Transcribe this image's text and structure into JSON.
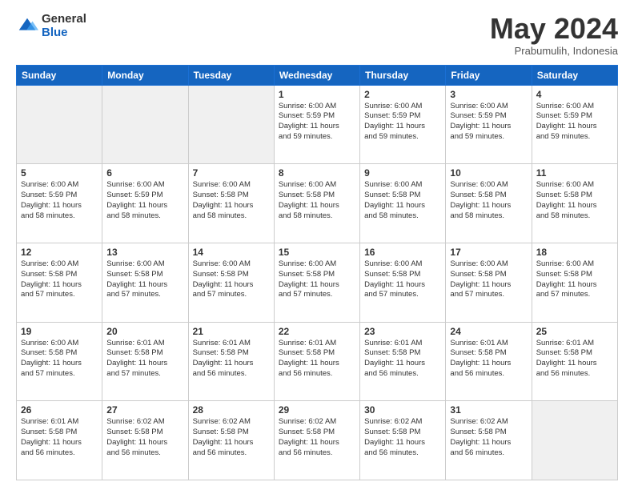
{
  "header": {
    "logo_general": "General",
    "logo_blue": "Blue",
    "month": "May 2024",
    "location": "Prabumulih, Indonesia"
  },
  "weekdays": [
    "Sunday",
    "Monday",
    "Tuesday",
    "Wednesday",
    "Thursday",
    "Friday",
    "Saturday"
  ],
  "weeks": [
    [
      {
        "day": "",
        "info": "",
        "empty": true
      },
      {
        "day": "",
        "info": "",
        "empty": true
      },
      {
        "day": "",
        "info": "",
        "empty": true
      },
      {
        "day": "1",
        "info": "Sunrise: 6:00 AM\nSunset: 5:59 PM\nDaylight: 11 hours\nand 59 minutes.",
        "empty": false
      },
      {
        "day": "2",
        "info": "Sunrise: 6:00 AM\nSunset: 5:59 PM\nDaylight: 11 hours\nand 59 minutes.",
        "empty": false
      },
      {
        "day": "3",
        "info": "Sunrise: 6:00 AM\nSunset: 5:59 PM\nDaylight: 11 hours\nand 59 minutes.",
        "empty": false
      },
      {
        "day": "4",
        "info": "Sunrise: 6:00 AM\nSunset: 5:59 PM\nDaylight: 11 hours\nand 59 minutes.",
        "empty": false
      }
    ],
    [
      {
        "day": "5",
        "info": "Sunrise: 6:00 AM\nSunset: 5:59 PM\nDaylight: 11 hours\nand 58 minutes.",
        "empty": false
      },
      {
        "day": "6",
        "info": "Sunrise: 6:00 AM\nSunset: 5:59 PM\nDaylight: 11 hours\nand 58 minutes.",
        "empty": false
      },
      {
        "day": "7",
        "info": "Sunrise: 6:00 AM\nSunset: 5:58 PM\nDaylight: 11 hours\nand 58 minutes.",
        "empty": false
      },
      {
        "day": "8",
        "info": "Sunrise: 6:00 AM\nSunset: 5:58 PM\nDaylight: 11 hours\nand 58 minutes.",
        "empty": false
      },
      {
        "day": "9",
        "info": "Sunrise: 6:00 AM\nSunset: 5:58 PM\nDaylight: 11 hours\nand 58 minutes.",
        "empty": false
      },
      {
        "day": "10",
        "info": "Sunrise: 6:00 AM\nSunset: 5:58 PM\nDaylight: 11 hours\nand 58 minutes.",
        "empty": false
      },
      {
        "day": "11",
        "info": "Sunrise: 6:00 AM\nSunset: 5:58 PM\nDaylight: 11 hours\nand 58 minutes.",
        "empty": false
      }
    ],
    [
      {
        "day": "12",
        "info": "Sunrise: 6:00 AM\nSunset: 5:58 PM\nDaylight: 11 hours\nand 57 minutes.",
        "empty": false
      },
      {
        "day": "13",
        "info": "Sunrise: 6:00 AM\nSunset: 5:58 PM\nDaylight: 11 hours\nand 57 minutes.",
        "empty": false
      },
      {
        "day": "14",
        "info": "Sunrise: 6:00 AM\nSunset: 5:58 PM\nDaylight: 11 hours\nand 57 minutes.",
        "empty": false
      },
      {
        "day": "15",
        "info": "Sunrise: 6:00 AM\nSunset: 5:58 PM\nDaylight: 11 hours\nand 57 minutes.",
        "empty": false
      },
      {
        "day": "16",
        "info": "Sunrise: 6:00 AM\nSunset: 5:58 PM\nDaylight: 11 hours\nand 57 minutes.",
        "empty": false
      },
      {
        "day": "17",
        "info": "Sunrise: 6:00 AM\nSunset: 5:58 PM\nDaylight: 11 hours\nand 57 minutes.",
        "empty": false
      },
      {
        "day": "18",
        "info": "Sunrise: 6:00 AM\nSunset: 5:58 PM\nDaylight: 11 hours\nand 57 minutes.",
        "empty": false
      }
    ],
    [
      {
        "day": "19",
        "info": "Sunrise: 6:00 AM\nSunset: 5:58 PM\nDaylight: 11 hours\nand 57 minutes.",
        "empty": false
      },
      {
        "day": "20",
        "info": "Sunrise: 6:01 AM\nSunset: 5:58 PM\nDaylight: 11 hours\nand 57 minutes.",
        "empty": false
      },
      {
        "day": "21",
        "info": "Sunrise: 6:01 AM\nSunset: 5:58 PM\nDaylight: 11 hours\nand 56 minutes.",
        "empty": false
      },
      {
        "day": "22",
        "info": "Sunrise: 6:01 AM\nSunset: 5:58 PM\nDaylight: 11 hours\nand 56 minutes.",
        "empty": false
      },
      {
        "day": "23",
        "info": "Sunrise: 6:01 AM\nSunset: 5:58 PM\nDaylight: 11 hours\nand 56 minutes.",
        "empty": false
      },
      {
        "day": "24",
        "info": "Sunrise: 6:01 AM\nSunset: 5:58 PM\nDaylight: 11 hours\nand 56 minutes.",
        "empty": false
      },
      {
        "day": "25",
        "info": "Sunrise: 6:01 AM\nSunset: 5:58 PM\nDaylight: 11 hours\nand 56 minutes.",
        "empty": false
      }
    ],
    [
      {
        "day": "26",
        "info": "Sunrise: 6:01 AM\nSunset: 5:58 PM\nDaylight: 11 hours\nand 56 minutes.",
        "empty": false
      },
      {
        "day": "27",
        "info": "Sunrise: 6:02 AM\nSunset: 5:58 PM\nDaylight: 11 hours\nand 56 minutes.",
        "empty": false
      },
      {
        "day": "28",
        "info": "Sunrise: 6:02 AM\nSunset: 5:58 PM\nDaylight: 11 hours\nand 56 minutes.",
        "empty": false
      },
      {
        "day": "29",
        "info": "Sunrise: 6:02 AM\nSunset: 5:58 PM\nDaylight: 11 hours\nand 56 minutes.",
        "empty": false
      },
      {
        "day": "30",
        "info": "Sunrise: 6:02 AM\nSunset: 5:58 PM\nDaylight: 11 hours\nand 56 minutes.",
        "empty": false
      },
      {
        "day": "31",
        "info": "Sunrise: 6:02 AM\nSunset: 5:58 PM\nDaylight: 11 hours\nand 56 minutes.",
        "empty": false
      },
      {
        "day": "",
        "info": "",
        "empty": true
      }
    ]
  ]
}
